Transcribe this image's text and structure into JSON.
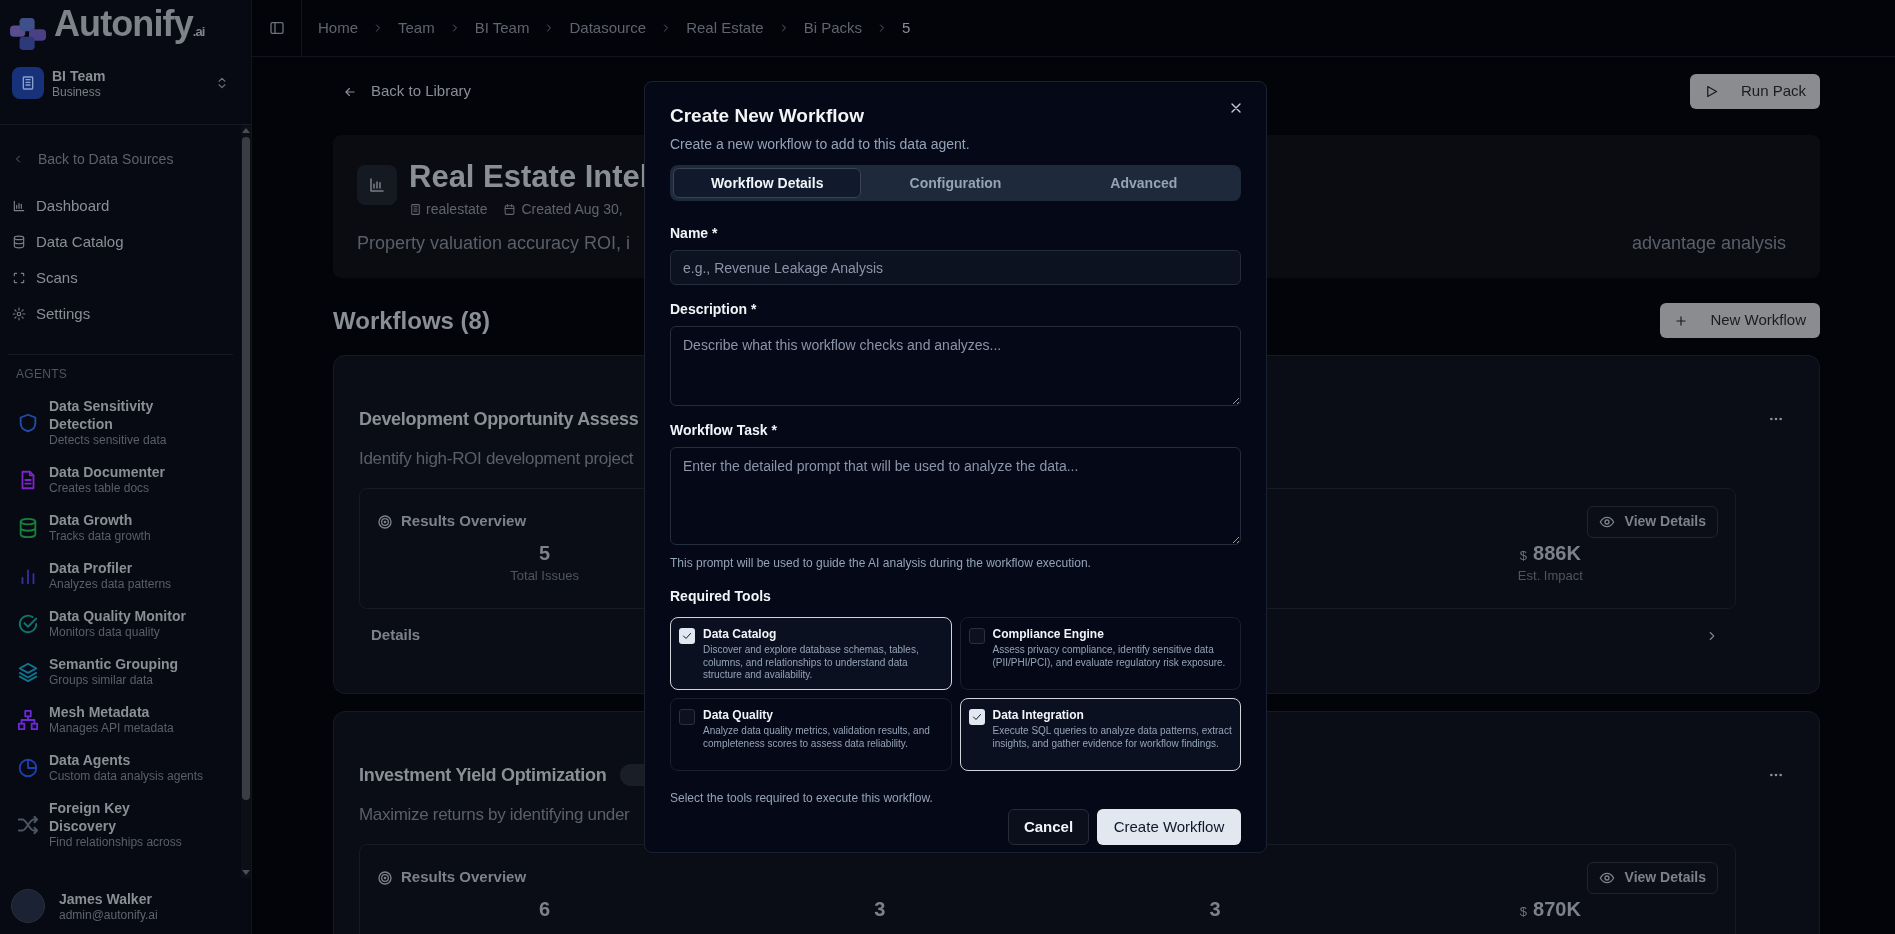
{
  "sidebar": {
    "logo": {
      "name": "Autonify",
      "suffix": ".ai"
    },
    "team": {
      "name": "BI Team",
      "plan": "Business"
    },
    "back_link": "Back to Data Sources",
    "nav": [
      {
        "label": "Dashboard"
      },
      {
        "label": "Data Catalog"
      },
      {
        "label": "Scans"
      },
      {
        "label": "Settings"
      }
    ],
    "agents_heading": "AGENTS",
    "agents": [
      {
        "name": "Data Sensitivity Detection",
        "description": "Detects sensitive data",
        "color": "#1e4fa8"
      },
      {
        "name": "Data Documenter",
        "description": "Creates table docs",
        "color": "#7e22ce"
      },
      {
        "name": "Data Growth",
        "description": "Tracks data growth",
        "color": "#15803d"
      },
      {
        "name": "Data Profiler",
        "description": "Analyzes data patterns",
        "color": "#3730a3"
      },
      {
        "name": "Data Quality Monitor",
        "description": "Monitors data quality",
        "color": "#0f766e"
      },
      {
        "name": "Semantic Grouping",
        "description": "Groups similar data",
        "color": "#0e7490"
      },
      {
        "name": "Mesh Metadata",
        "description": "Manages API metadata",
        "color": "#6d28d9"
      },
      {
        "name": "Data Agents",
        "description": "Custom data analysis agents",
        "color": "#1e40af"
      },
      {
        "name": "Foreign Key Discovery",
        "description": "Find relationships across",
        "color": "#4b5563"
      }
    ],
    "user": {
      "name": "James Walker",
      "email": "admin@autonify.ai"
    }
  },
  "breadcrumb": [
    "Home",
    "Team",
    "BI Team",
    "Datasource",
    "Real Estate",
    "Bi Packs",
    "5"
  ],
  "back_link": "Back to Library",
  "run_button": "Run Pack",
  "pack": {
    "title": "Real Estate Intel",
    "source": "realestate",
    "created": "Created Aug 30,",
    "description_left": "Property valuation accuracy ROI, i",
    "description_right": "advantage analysis"
  },
  "workflows_heading": "Workflows (8)",
  "new_workflow_button": "New Workflow",
  "workflow_cards": [
    {
      "title": "Development Opportunity Assess",
      "description": "Identify high-ROI development project",
      "results_title": "Results Overview",
      "view_details": "View Details",
      "stats": [
        {
          "value": "5",
          "label": "Total Issues"
        }
      ],
      "impact": {
        "currency": "$",
        "value": "886K",
        "label": "Est. Impact"
      },
      "details_label": "Details"
    },
    {
      "title": "Investment Yield Optimization",
      "description": "Maximize returns by identifying under",
      "results_title": "Results Overview",
      "view_details": "View Details",
      "stats": [
        {
          "value": "6"
        },
        {
          "value": "3"
        },
        {
          "value": "3"
        }
      ],
      "impact": {
        "currency": "$",
        "value": "870K"
      }
    }
  ],
  "modal": {
    "title": "Create New Workflow",
    "subtitle": "Create a new workflow to add to this data agent.",
    "tabs": [
      {
        "label": "Workflow Details",
        "selected": true
      },
      {
        "label": "Configuration",
        "selected": false
      },
      {
        "label": "Advanced",
        "selected": false
      }
    ],
    "name_field": {
      "label": "Name *",
      "placeholder": "e.g., Revenue Leakage Analysis"
    },
    "description_field": {
      "label": "Description *",
      "placeholder": "Describe what this workflow checks and analyzes..."
    },
    "task_field": {
      "label": "Workflow Task *",
      "placeholder": "Enter the detailed prompt that will be used to analyze the data...",
      "hint": "This prompt will be used to guide the AI analysis during the workflow execution."
    },
    "tools_heading": "Required Tools",
    "tools": [
      {
        "name": "Data Catalog",
        "description": "Discover and explore database schemas, tables, columns, and relationships to understand data structure and availability.",
        "checked": true
      },
      {
        "name": "Compliance Engine",
        "description": "Assess privacy compliance, identify sensitive data (PII/PHI/PCI), and evaluate regulatory risk exposure.",
        "checked": false
      },
      {
        "name": "Data Quality",
        "description": "Analyze data quality metrics, validation results, and completeness scores to assess data reliability.",
        "checked": false
      },
      {
        "name": "Data Integration",
        "description": "Execute SQL queries to analyze data patterns, extract insights, and gather evidence for workflow findings.",
        "checked": true
      }
    ],
    "tools_hint": "Select the tools required to execute this workflow.",
    "cancel_button": "Cancel",
    "create_button": "Create Workflow"
  }
}
